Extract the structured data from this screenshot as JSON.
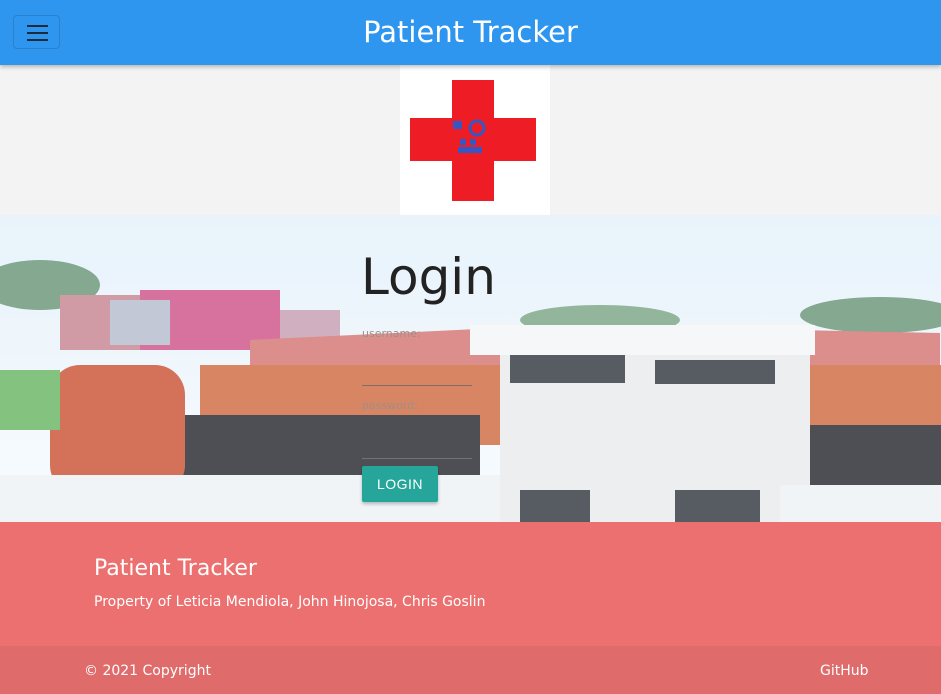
{
  "navbar": {
    "brand": "Patient Tracker",
    "menu_icon": "hamburger-menu-icon",
    "color": "#2e96ee"
  },
  "logo": {
    "icon": "red-cross-logo",
    "cross_color": "#ee1c25",
    "emblem_color": "#3557c4"
  },
  "login": {
    "title": "Login",
    "username_label": "username:",
    "password_label": "password:",
    "button_label": "LOGIN",
    "button_color": "#26a69a"
  },
  "footer": {
    "title": "Patient Tracker",
    "subtitle": "Property of Leticia Mendiola, John Hinojosa, Chris Goslin",
    "copyright": "© 2021 Copyright",
    "github_label": "GitHub",
    "color": "#ec7070"
  }
}
